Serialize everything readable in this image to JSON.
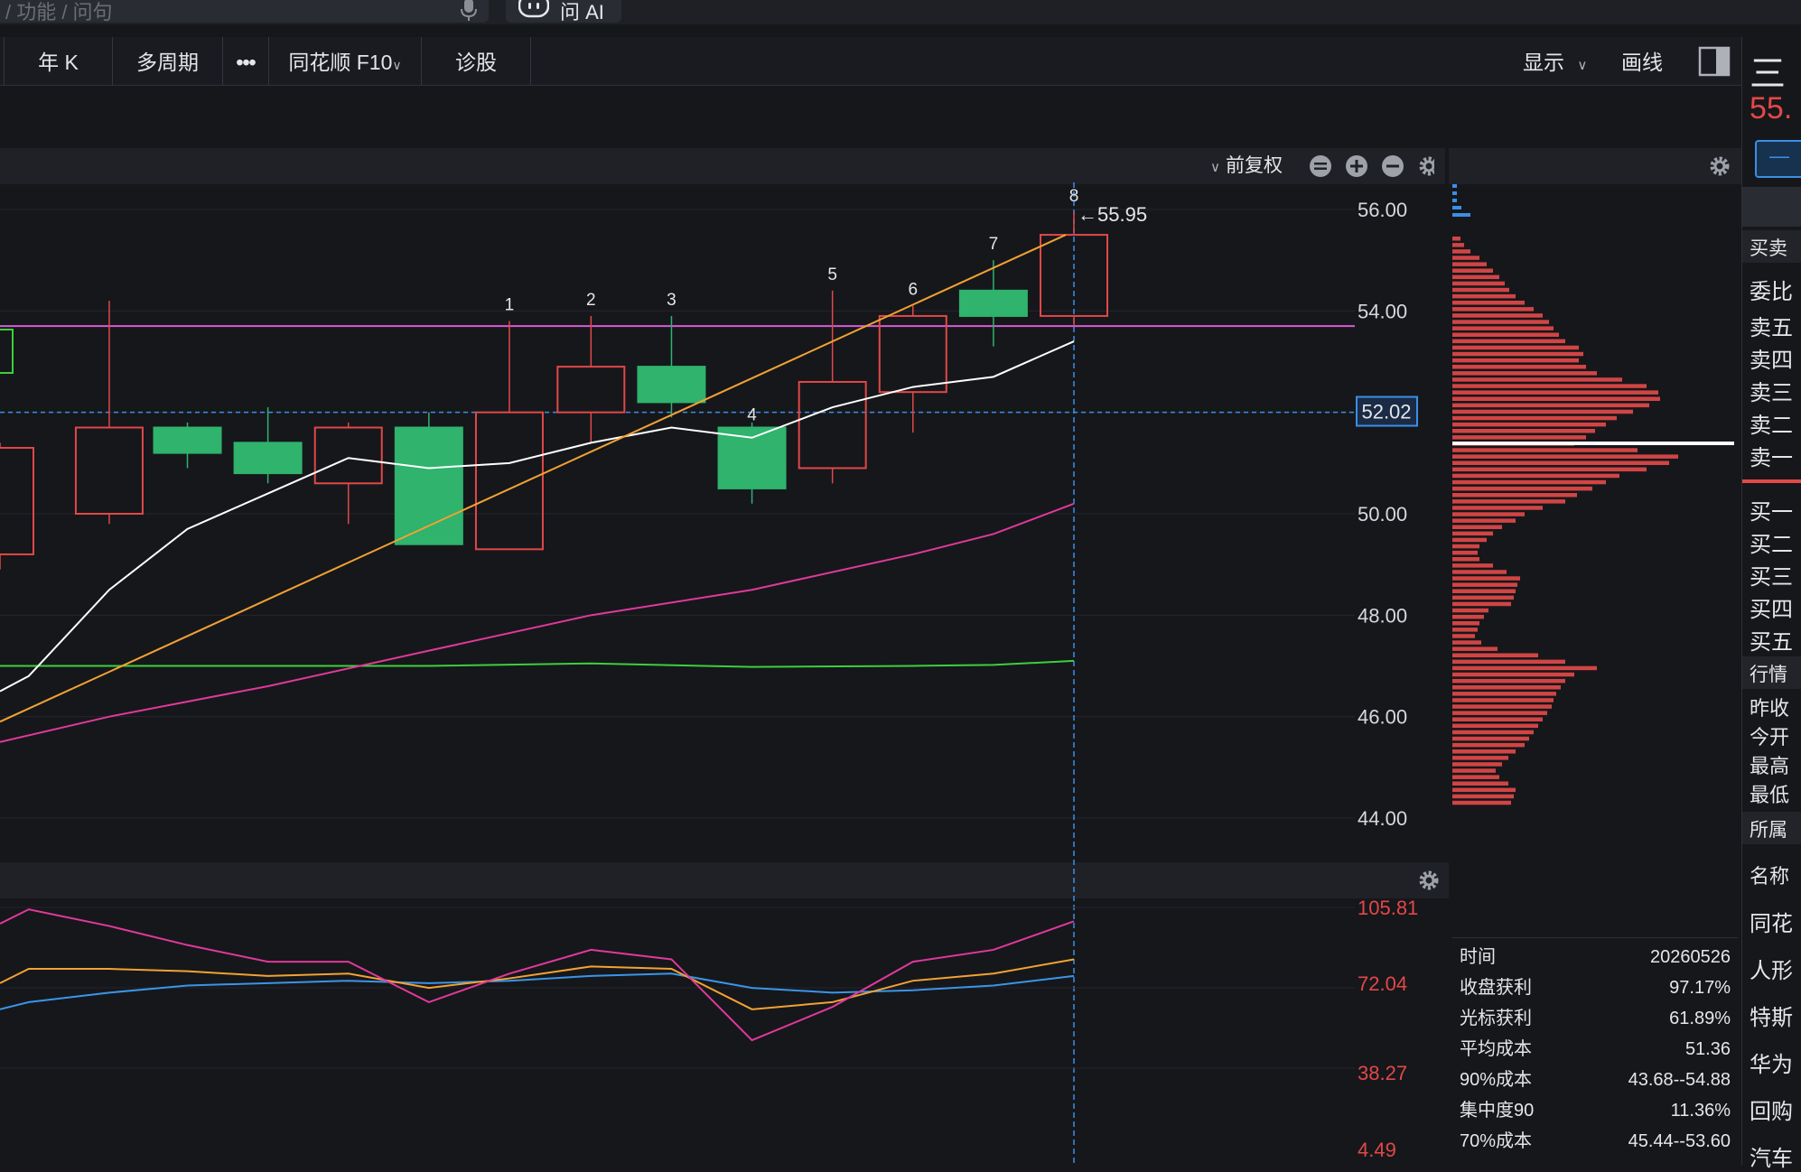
{
  "search": {
    "placeholder": "/ 功能 / 问句"
  },
  "ask_ai": {
    "label": "问 AI"
  },
  "toolbar": {
    "items": [
      "年 K",
      "多周期",
      "•••",
      "同花顺 F10",
      "诊股"
    ],
    "display_label": "显示",
    "draw_label": "画线"
  },
  "chart_header": {
    "adjust_label": "前复权"
  },
  "chart_data": {
    "type": "candlestick",
    "price_axis_ticks": [
      "56.00",
      "54.00",
      "52.00",
      "50.00",
      "48.00",
      "46.00",
      "44.00"
    ],
    "price_ylim": [
      42.8,
      57.0
    ],
    "current_price_label": "52.02",
    "high_marker_label": "←55.95",
    "candles": [
      {
        "x": 0,
        "open": 51.3,
        "close": 49.2,
        "high": 51.4,
        "low": 48.9,
        "dir": "up"
      },
      {
        "x": 95,
        "open": 50.0,
        "close": 51.7,
        "high": 54.2,
        "low": 49.8,
        "dir": "up"
      },
      {
        "x": 163,
        "open": 51.7,
        "close": 51.2,
        "high": 51.8,
        "low": 50.9,
        "dir": "down"
      },
      {
        "x": 233,
        "open": 51.4,
        "close": 50.8,
        "high": 52.1,
        "low": 50.6,
        "dir": "down"
      },
      {
        "x": 303,
        "open": 50.6,
        "close": 51.7,
        "high": 51.8,
        "low": 49.8,
        "dir": "up"
      },
      {
        "x": 373,
        "open": 51.7,
        "close": 49.4,
        "high": 52.0,
        "low": 49.4,
        "dir": "down"
      },
      {
        "x": 443,
        "open": 49.3,
        "close": 52.0,
        "high": 53.8,
        "low": 49.3,
        "dir": "up"
      },
      {
        "x": 514,
        "open": 52.0,
        "close": 52.9,
        "high": 53.9,
        "low": 51.4,
        "dir": "up"
      },
      {
        "x": 584,
        "open": 52.9,
        "close": 52.2,
        "high": 53.9,
        "low": 51.9,
        "dir": "down"
      },
      {
        "x": 654,
        "open": 51.7,
        "close": 50.5,
        "high": 51.8,
        "low": 50.2,
        "dir": "down"
      },
      {
        "x": 724,
        "open": 50.9,
        "close": 52.6,
        "high": 54.4,
        "low": 50.6,
        "dir": "up"
      },
      {
        "x": 794,
        "open": 52.4,
        "close": 53.9,
        "high": 54.1,
        "low": 51.6,
        "dir": "up"
      },
      {
        "x": 864,
        "open": 54.4,
        "close": 53.9,
        "high": 55.0,
        "low": 53.3,
        "dir": "down"
      },
      {
        "x": 934,
        "open": 53.9,
        "close": 55.5,
        "high": 55.95,
        "low": 53.7,
        "dir": "up"
      }
    ],
    "candle_labels": [
      {
        "text": "1",
        "x": 443
      },
      {
        "text": "2",
        "x": 514
      },
      {
        "text": "3",
        "x": 584
      },
      {
        "text": "4",
        "x": 654
      },
      {
        "text": "5",
        "x": 724
      },
      {
        "text": "6",
        "x": 794
      },
      {
        "text": "7",
        "x": 864
      },
      {
        "text": "8",
        "x": 934
      }
    ],
    "ma_white": [
      [
        0,
        46.5
      ],
      [
        25,
        46.8
      ],
      [
        95,
        48.5
      ],
      [
        163,
        49.7
      ],
      [
        233,
        50.4
      ],
      [
        303,
        51.1
      ],
      [
        373,
        50.9
      ],
      [
        443,
        51.0
      ],
      [
        514,
        51.4
      ],
      [
        584,
        51.7
      ],
      [
        654,
        51.5
      ],
      [
        724,
        52.1
      ],
      [
        794,
        52.5
      ],
      [
        864,
        52.7
      ],
      [
        934,
        53.4
      ]
    ],
    "ma_magenta": [
      [
        0,
        45.5
      ],
      [
        95,
        46.0
      ],
      [
        233,
        46.6
      ],
      [
        373,
        47.3
      ],
      [
        514,
        48.0
      ],
      [
        654,
        48.5
      ],
      [
        794,
        49.2
      ],
      [
        864,
        49.6
      ],
      [
        934,
        50.2
      ]
    ],
    "ma_green": [
      [
        0,
        47.0
      ],
      [
        373,
        47.0
      ],
      [
        514,
        47.05
      ],
      [
        654,
        46.98
      ],
      [
        794,
        47.0
      ],
      [
        864,
        47.02
      ],
      [
        934,
        47.1
      ]
    ],
    "trend_orange": [
      [
        0,
        45.9
      ],
      [
        1180,
        55.5
      ]
    ],
    "resistance_magenta_level": 53.7,
    "indicator": {
      "axis_ticks": [
        "105.81",
        "72.04",
        "38.27",
        "4.49"
      ],
      "ylim": [
        4.49,
        105.81
      ],
      "pink": [
        [
          0,
          99
        ],
        [
          25,
          105
        ],
        [
          95,
          98
        ],
        [
          163,
          90
        ],
        [
          233,
          83
        ],
        [
          303,
          83
        ],
        [
          373,
          66
        ],
        [
          443,
          78
        ],
        [
          514,
          88
        ],
        [
          584,
          84
        ],
        [
          654,
          50
        ],
        [
          724,
          64
        ],
        [
          794,
          83
        ],
        [
          864,
          88
        ],
        [
          934,
          100
        ]
      ],
      "orange": [
        [
          0,
          74
        ],
        [
          25,
          80
        ],
        [
          95,
          80
        ],
        [
          163,
          79
        ],
        [
          233,
          77
        ],
        [
          303,
          78
        ],
        [
          373,
          72
        ],
        [
          443,
          76
        ],
        [
          514,
          81
        ],
        [
          584,
          80
        ],
        [
          654,
          63
        ],
        [
          724,
          66
        ],
        [
          794,
          75
        ],
        [
          864,
          78
        ],
        [
          934,
          84
        ]
      ],
      "blue": [
        [
          0,
          63
        ],
        [
          25,
          66
        ],
        [
          95,
          70
        ],
        [
          163,
          73
        ],
        [
          233,
          74
        ],
        [
          303,
          75
        ],
        [
          373,
          74
        ],
        [
          443,
          75
        ],
        [
          514,
          77
        ],
        [
          584,
          78
        ],
        [
          654,
          72
        ],
        [
          724,
          70
        ],
        [
          794,
          71
        ],
        [
          864,
          73
        ],
        [
          934,
          77
        ]
      ]
    },
    "volume_profile": [
      9,
      13,
      20,
      30,
      38,
      45,
      52,
      58,
      63,
      70,
      80,
      90,
      100,
      107,
      112,
      118,
      125,
      140,
      145,
      140,
      148,
      160,
      188,
      215,
      228,
      230,
      218,
      200,
      182,
      170,
      158,
      148,
      135,
      205,
      250,
      240,
      215,
      185,
      170,
      155,
      138,
      125,
      100,
      80,
      70,
      55,
      45,
      38,
      30,
      28,
      30,
      45,
      60,
      75,
      72,
      70,
      68,
      65,
      40,
      35,
      30,
      28,
      25,
      32,
      50,
      95,
      125,
      160,
      135,
      125,
      120,
      115,
      112,
      110,
      105,
      100,
      95,
      90,
      85,
      80,
      70,
      62,
      55,
      48,
      52,
      62,
      70,
      68,
      65
    ]
  },
  "order_panel": {
    "title_char": "三",
    "price_fragment": "55.",
    "sections": [
      "买卖",
      "行情",
      "所属"
    ],
    "labels": [
      "委比",
      "卖五",
      "卖四",
      "卖三",
      "卖二",
      "卖一",
      "买一",
      "买二",
      "买三",
      "买四",
      "买五",
      "昨收",
      "今开",
      "最高",
      "最低",
      "名称",
      "同花",
      "人形",
      "特斯",
      "华为",
      "回购",
      "汽车"
    ]
  },
  "chip_stats": {
    "rows": [
      {
        "key": "时间",
        "value": "20260526"
      },
      {
        "key": "收盘获利",
        "value": "97.17%"
      },
      {
        "key": "光标获利",
        "value": "61.89%"
      },
      {
        "key": "平均成本",
        "value": "51.36"
      },
      {
        "key": "90%成本",
        "value": "43.68--54.88"
      },
      {
        "key": "集中度90",
        "value": "11.36%"
      },
      {
        "key": "70%成本",
        "value": "45.44--53.60"
      }
    ]
  },
  "colors": {
    "up": "#e04848",
    "down": "#2fb36d",
    "ma_white": "#ffffff",
    "ma_magenta": "#e0399a",
    "ma_green": "#3ad13a",
    "trend": "#f2a233",
    "resistance": "#d65bd6",
    "price_red": "#e24848",
    "crosshair": "#3b8fe6"
  }
}
